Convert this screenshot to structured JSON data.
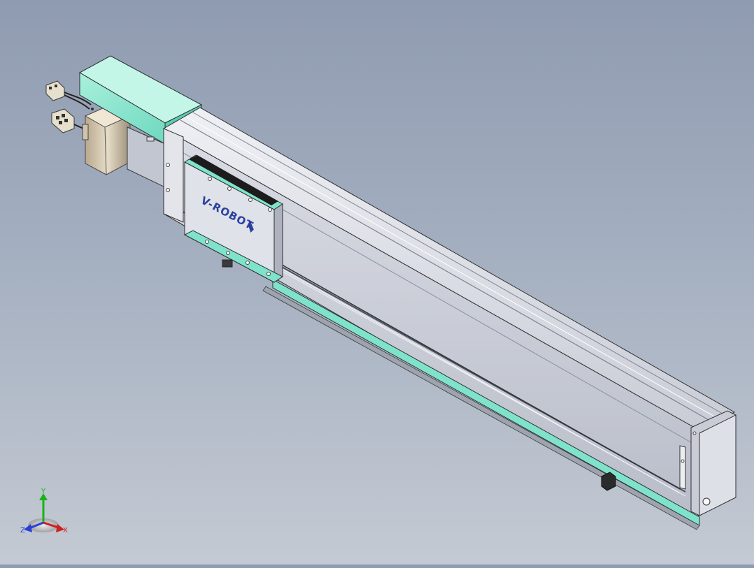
{
  "model": {
    "carriage_logo_text": "V-ROBOT",
    "colors": {
      "background_top": "#8f9bb0",
      "background_bottom": "#c4cad3",
      "accent_mint": "#7fe3cc",
      "aluminum": "#d3d6de",
      "aluminum_dark": "#9ea3b0",
      "logo_blue": "#2b3f9e"
    }
  },
  "triad": {
    "x_label": "X",
    "y_label": "Y",
    "z_label": "Z",
    "x_color": "#d11e1e",
    "y_color": "#19b319",
    "z_color": "#2a3fd6"
  }
}
